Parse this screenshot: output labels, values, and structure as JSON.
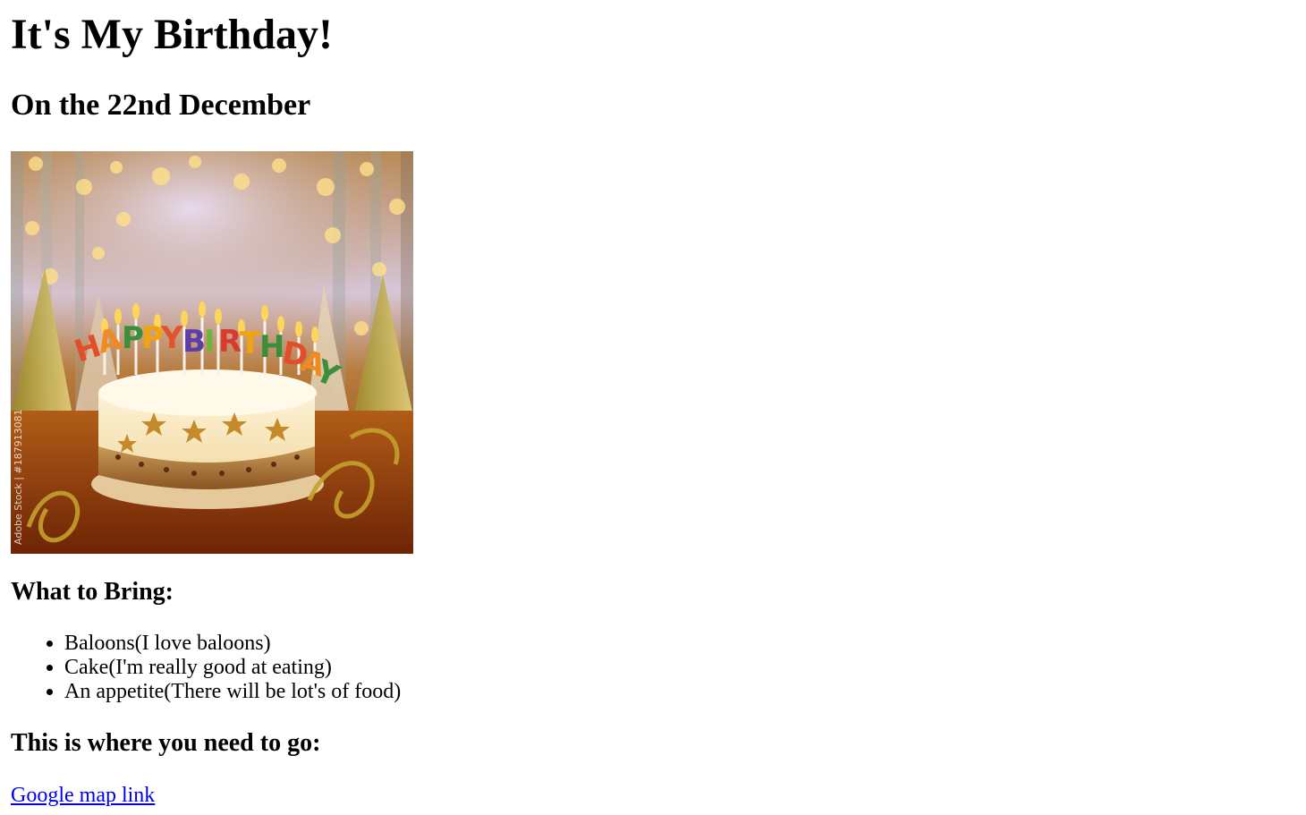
{
  "page": {
    "title": "It's My Birthday!",
    "subtitle": "On the 22nd December"
  },
  "image": {
    "caption_text": "HAPPY BIRTHDAY",
    "watermark": "Adobe Stock | #187913081"
  },
  "bring": {
    "heading": "What to Bring:",
    "items": [
      "Baloons(I love baloons)",
      "Cake(I'm really good at eating)",
      "An appetite(There will be lot's of food)"
    ]
  },
  "location": {
    "heading": "This is where you need to go:",
    "link_text": "Google map link"
  },
  "colors": {
    "link": "#0000ee",
    "text": "#000000",
    "background": "#ffffff"
  }
}
